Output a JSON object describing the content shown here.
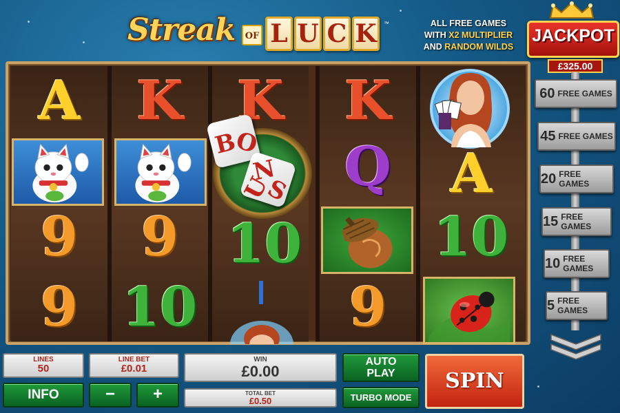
{
  "logo": {
    "streak": "Streak",
    "of": "OF",
    "luck": [
      "L",
      "U",
      "C",
      "K"
    ],
    "tm": "™"
  },
  "promo": {
    "line1": "ALL FREE GAMES",
    "line2_prefix": "WITH ",
    "line2_highlight": "X2 MULTIPLIER",
    "line3_prefix": "AND ",
    "line3_highlight": "RANDOM WILDS"
  },
  "jackpot": {
    "title": "JACKPOT",
    "amount": "£325.00"
  },
  "free_games": [
    {
      "count": "60",
      "label": "FREE GAMES"
    },
    {
      "count": "45",
      "label": "FREE GAMES"
    },
    {
      "count": "20",
      "label": "FREE GAMES"
    },
    {
      "count": "15",
      "label": "FREE GAMES"
    },
    {
      "count": "10",
      "label": "FREE GAMES"
    },
    {
      "count": "5",
      "label": "FREE GAMES"
    }
  ],
  "reels": {
    "reel1": {
      "row1": "A",
      "row3": "9",
      "row4": "9"
    },
    "reel2": {
      "row1": "K",
      "row3": "9",
      "row4": "10"
    },
    "reel3": {
      "row1": "K",
      "row3": "10"
    },
    "reel4": {
      "row1": "K",
      "row2": "Q",
      "row4": "9"
    },
    "reel5": {
      "row2": "A",
      "row3": "10"
    },
    "bonus_dice": {
      "die1": [
        "B",
        "O"
      ],
      "die2": [
        "N",
        "U",
        "S"
      ]
    }
  },
  "controls": {
    "lines_label": "LINES",
    "lines_value": "50",
    "line_bet_label": "LINE BET",
    "line_bet_value": "£0.01",
    "win_label": "WIN",
    "win_value": "£0.00",
    "total_bet_label": "TOTAL BET",
    "total_bet_value": "£0.50",
    "info": "INFO",
    "minus": "−",
    "plus": "+",
    "auto_play_line1": "AUTO",
    "auto_play_line2": "PLAY",
    "turbo_mode": "TURBO MODE",
    "spin": "SPIN"
  }
}
